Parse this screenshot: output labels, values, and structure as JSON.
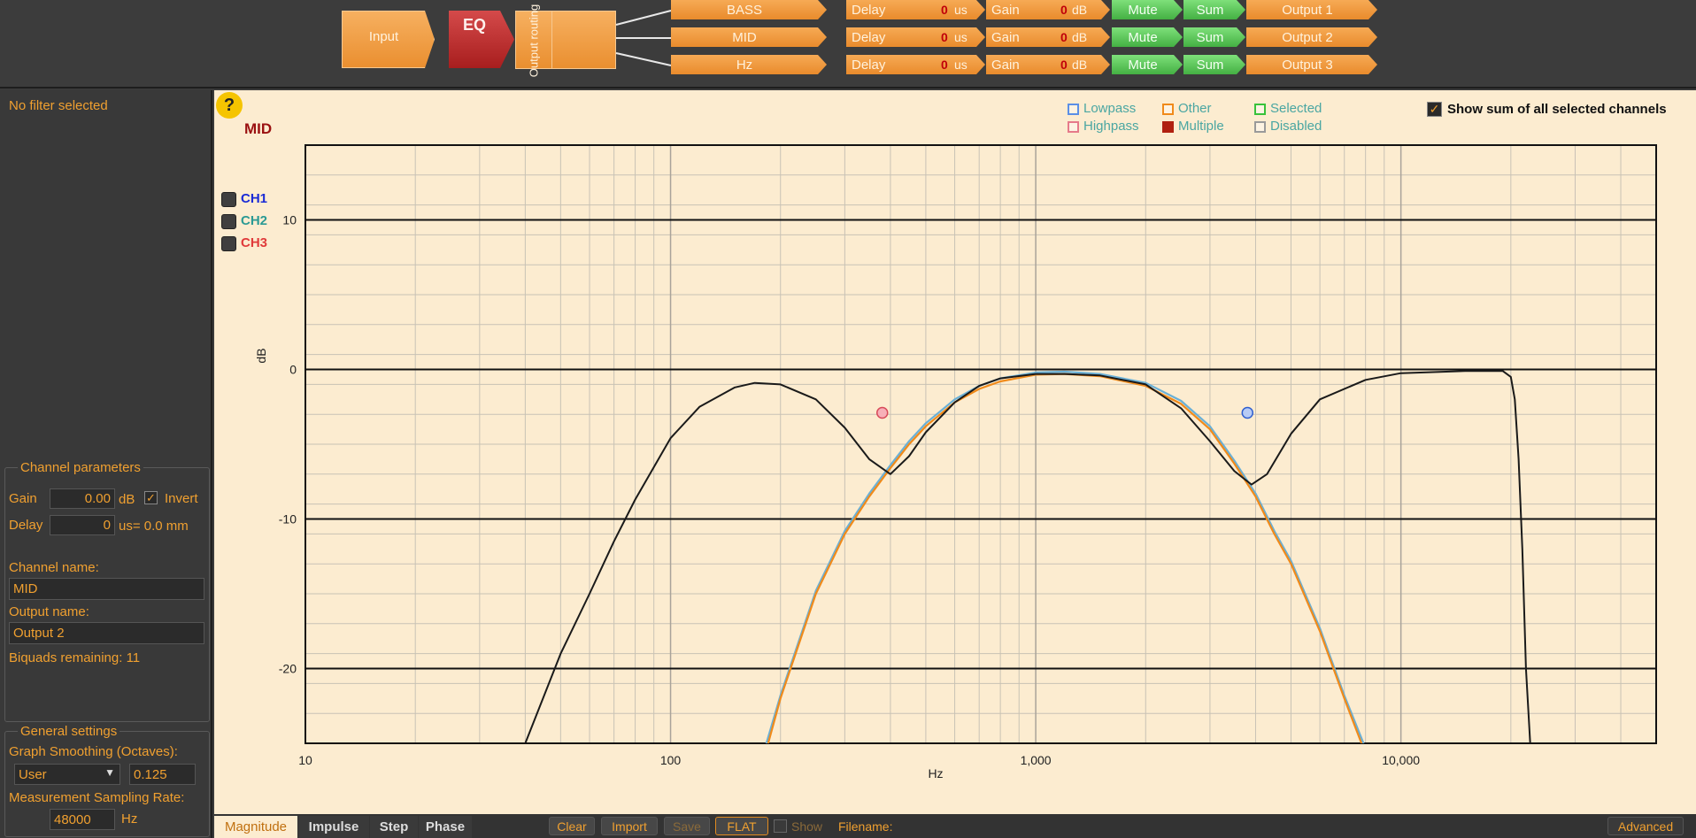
{
  "pipeline": {
    "input_label": "Input",
    "eq_label": "EQ",
    "routing_label": "Output routing",
    "channels": [
      {
        "name": "BASS",
        "delay_label": "Delay",
        "delay_value": "0",
        "delay_unit": "us",
        "gain_label": "Gain",
        "gain_value": "0",
        "gain_unit": "dB",
        "mute_label": "Mute",
        "sum_label": "Sum",
        "output_label": "Output 1"
      },
      {
        "name": "MID",
        "delay_label": "Delay",
        "delay_value": "0",
        "delay_unit": "us",
        "gain_label": "Gain",
        "gain_value": "0",
        "gain_unit": "dB",
        "mute_label": "Mute",
        "sum_label": "Sum",
        "output_label": "Output 2"
      },
      {
        "name": "Hz",
        "delay_label": "Delay",
        "delay_value": "0",
        "delay_unit": "us",
        "gain_label": "Gain",
        "gain_value": "0",
        "gain_unit": "dB",
        "mute_label": "Mute",
        "sum_label": "Sum",
        "output_label": "Output 3"
      }
    ]
  },
  "sidebar": {
    "status": "No filter selected",
    "channel_params": {
      "title": "Channel parameters",
      "gain_label": "Gain",
      "gain_value": "0.00",
      "gain_unit": "dB",
      "invert_label": "Invert",
      "invert_checked": true,
      "delay_label": "Delay",
      "delay_value": "0",
      "delay_unit": "us= 0.0 mm",
      "channel_name_label": "Channel name:",
      "channel_name_value": "MID",
      "output_name_label": "Output name:",
      "output_name_value": "Output 2",
      "biquads": "Biquads remaining: 11"
    },
    "general": {
      "title": "General settings",
      "smoothing_label": "Graph Smoothing (Octaves):",
      "smoothing_mode": "User",
      "smoothing_value": "0.125",
      "sampling_label": "Measurement Sampling Rate:",
      "sampling_value": "48000",
      "sampling_unit": "Hz"
    }
  },
  "graph": {
    "help_icon": "?",
    "channel_title": "MID",
    "channels": [
      {
        "label": "CH1",
        "color": "#1a2bd6"
      },
      {
        "label": "CH2",
        "color": "#2b9a94"
      },
      {
        "label": "CH3",
        "color": "#e03a3a"
      }
    ],
    "legend": [
      {
        "label": "Lowpass",
        "color": "#5b8fe6"
      },
      {
        "label": "Other",
        "color": "#f08a1a"
      },
      {
        "label": "Selected",
        "color": "#38c23a"
      },
      {
        "label": "Highpass",
        "color": "#e67a8a"
      },
      {
        "label": "Multiple",
        "color": "#b02010"
      },
      {
        "label": "Disabled",
        "color": "#9a9a9a"
      }
    ],
    "show_sum_label": "Show sum of all selected channels",
    "show_sum_checked": true
  },
  "chart_data": {
    "type": "line",
    "title": "MID",
    "xlabel": "Hz",
    "ylabel": "dB",
    "x_scale": "log",
    "xlim": [
      10,
      50000
    ],
    "ylim": [
      -25,
      15
    ],
    "x_ticks": [
      10,
      100,
      1000,
      10000
    ],
    "x_tick_labels": [
      "10",
      "100",
      "1,000",
      "10,000"
    ],
    "y_ticks": [
      10,
      0,
      -10,
      -20
    ],
    "y_tick_labels": [
      "10",
      "0",
      "-10",
      "-20"
    ],
    "grid": true,
    "series": [
      {
        "color": "#1a1a1a",
        "x": [
          40,
          50,
          60,
          70,
          80,
          100,
          120,
          150,
          170,
          200,
          250,
          300,
          350,
          400,
          450,
          500,
          600,
          700,
          800,
          1000,
          1200,
          1500,
          2000,
          2500,
          3000,
          3500,
          3900,
          4300,
          5000,
          6000,
          8000,
          10000,
          15000,
          19000,
          20000,
          20500,
          21000,
          21500,
          22000,
          22600
        ],
        "y": [
          -25,
          -19,
          -15,
          -11.5,
          -8.7,
          -4.6,
          -2.5,
          -1.2,
          -0.9,
          -1,
          -2,
          -3.9,
          -6,
          -7,
          -5.8,
          -4.2,
          -2.2,
          -1.1,
          -0.6,
          -0.3,
          -0.3,
          -0.4,
          -1,
          -2.6,
          -4.8,
          -6.8,
          -7.7,
          -7,
          -4.3,
          -2,
          -0.7,
          -0.25,
          -0.1,
          -0.1,
          -0.5,
          -2,
          -6,
          -12,
          -20,
          -25
        ]
      },
      {
        "color": "#f08a1a",
        "x": [
          185,
          200,
          250,
          300,
          350,
          400,
          450,
          500,
          600,
          700,
          800,
          1000,
          1200,
          1500,
          2000,
          2500,
          3000,
          3500,
          4000,
          4500,
          5000,
          6000,
          7000,
          7800
        ],
        "y": [
          -25,
          -22,
          -15,
          -11,
          -8.5,
          -6.6,
          -5,
          -3.8,
          -2.2,
          -1.3,
          -0.8,
          -0.35,
          -0.3,
          -0.45,
          -1.1,
          -2.3,
          -4,
          -6.3,
          -8.5,
          -11,
          -13,
          -17.5,
          -22,
          -25
        ]
      },
      {
        "color": "#6ab0d6",
        "x": [
          183,
          200,
          250,
          300,
          350,
          400,
          450,
          500,
          600,
          700,
          800,
          1000,
          1200,
          1500,
          2000,
          2500,
          3000,
          3500,
          4000,
          4500,
          5000,
          6000,
          7000,
          7900
        ],
        "y": [
          -25,
          -21.8,
          -14.8,
          -10.8,
          -8.3,
          -6.4,
          -4.8,
          -3.6,
          -2,
          -1.1,
          -0.6,
          -0.2,
          -0.15,
          -0.3,
          -0.9,
          -2.1,
          -3.8,
          -6.1,
          -8.3,
          -10.8,
          -12.8,
          -17.3,
          -21.8,
          -25
        ]
      }
    ],
    "markers": [
      {
        "type": "highpass",
        "x": 380,
        "y": -2.9
      },
      {
        "type": "lowpass",
        "x": 3800,
        "y": -2.9
      }
    ]
  },
  "bottom": {
    "tabs": [
      "Magnitude",
      "Impulse",
      "Step",
      "Phase"
    ],
    "buttons": {
      "clear": "Clear",
      "import": "Import",
      "save": "Save",
      "flat": "FLAT",
      "show": "Show"
    },
    "filename_label": "Filename:",
    "advanced": "Advanced"
  }
}
